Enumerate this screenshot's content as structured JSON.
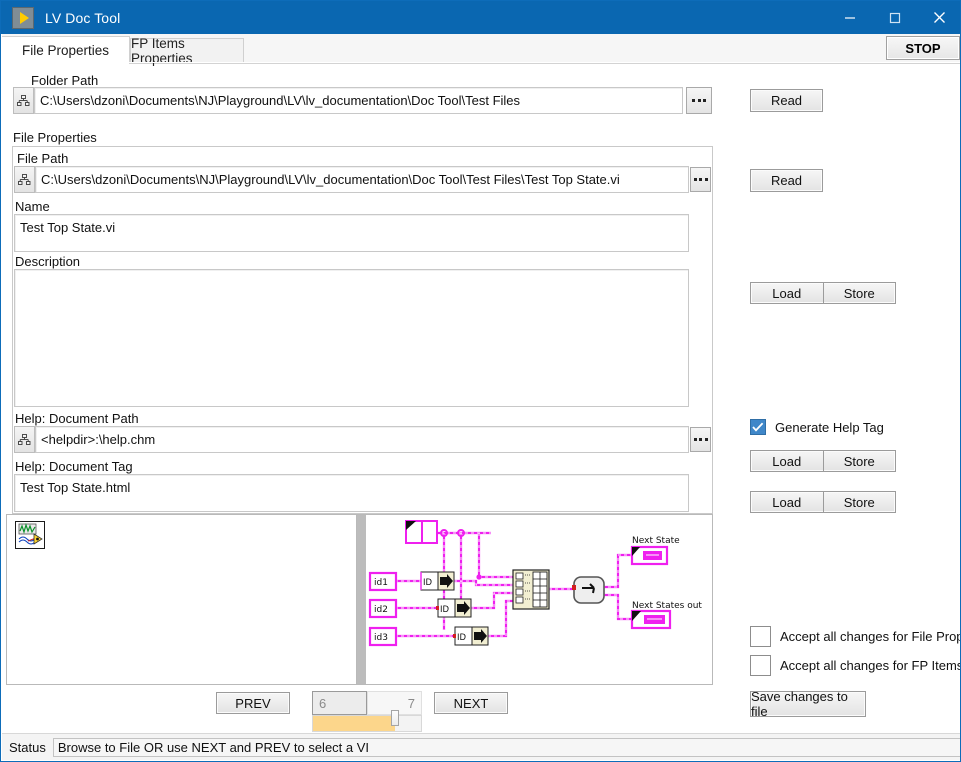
{
  "window": {
    "title": "LV Doc Tool",
    "icon": "labview-run-arrow-icon",
    "minimize": "minimize-icon",
    "maximize": "maximize-icon",
    "close": "close-icon",
    "titlebar_color": "#0a67b1"
  },
  "tabs": [
    {
      "label": "File Properties",
      "active": true
    },
    {
      "label": "FP Items Properties",
      "active": false
    }
  ],
  "toolbar": {
    "stop_label": "STOP"
  },
  "folder": {
    "label": "Folder Path",
    "value": "C:\\Users\\dzoni\\Documents\\NJ\\Playground\\LV\\lv_documentation\\Doc Tool\\Test Files",
    "browse_label": "...",
    "read_label": "Read"
  },
  "file_properties": {
    "group_label": "File Properties",
    "file_path": {
      "label": "File Path",
      "value": "C:\\Users\\dzoni\\Documents\\NJ\\Playground\\LV\\lv_documentation\\Doc Tool\\Test Files\\Test Top State.vi",
      "browse_label": "...",
      "read_label": "Read"
    },
    "name": {
      "label": "Name",
      "value": "Test Top State.vi"
    },
    "description": {
      "label": "Description",
      "value": ""
    },
    "help_document_path": {
      "label": "Help: Document Path",
      "value": "<helpdir>:\\help.chm",
      "browse_label": "..."
    },
    "help_document_tag": {
      "label": "Help: Document Tag",
      "value": "Test Top State.html"
    }
  },
  "right_panel": {
    "load_store_description": {
      "load": "Load",
      "store": "Store"
    },
    "generate_help_tag": {
      "label": "Generate Help Tag",
      "checked": true
    },
    "load_store_help_path": {
      "load": "Load",
      "store": "Store"
    },
    "load_store_help_tag": {
      "load": "Load",
      "store": "Store"
    },
    "accept_file_props": {
      "label": "Accept all changes for File Props",
      "checked": false
    },
    "accept_fp_items": {
      "label": "Accept all changes for FP Items",
      "checked": false
    },
    "save_button": "Save changes to file"
  },
  "preview": {
    "vi_icon": "vi-waveform-icon",
    "diagram": {
      "controls": [
        "id1",
        "id2",
        "id3"
      ],
      "indicators": [
        "Next State",
        "Next States out"
      ],
      "node_labels": [
        "ID",
        "ID",
        "ID"
      ]
    }
  },
  "navigation": {
    "prev": "PREV",
    "next": "NEXT",
    "current_index": "6",
    "max_index": "7",
    "slider_fill_color": "#fcd68b"
  },
  "status": {
    "label": "Status",
    "message": "Browse to File OR use NEXT and PREV to select a VI"
  }
}
